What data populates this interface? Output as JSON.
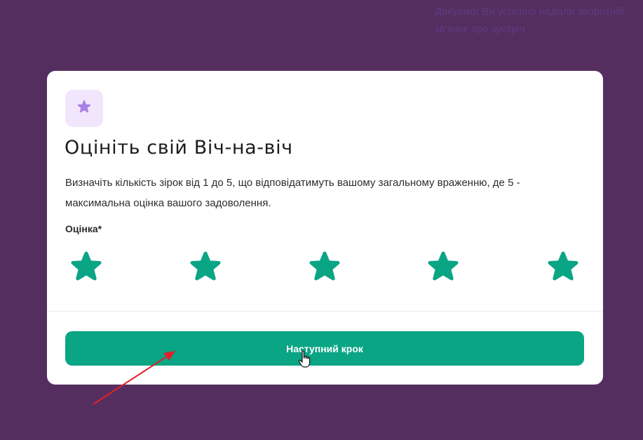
{
  "background": {
    "notification_text": "Дякуємо! Ви успішно надали зворотній зв'язок про зустріч"
  },
  "modal": {
    "header_icon": "star-icon",
    "title": "Оцініть свій Віч-на-віч",
    "description": "Визначіть кількість зірок від 1 до 5, що відповідатимуть вашому загальному враженню, де 5 - максимальна оцінка вашого задоволення.",
    "rating_label": "Оцінка*",
    "rating": {
      "max": 5,
      "selected": 5
    },
    "next_button_label": "Наступний крок"
  },
  "colors": {
    "page_background": "#552e60",
    "accent": "#0aa585",
    "star_fill": "#0aa585",
    "icon_tile": "#f1e6fb",
    "icon_star": "#a77fe6",
    "annotation_arrow": "#e0202a"
  }
}
